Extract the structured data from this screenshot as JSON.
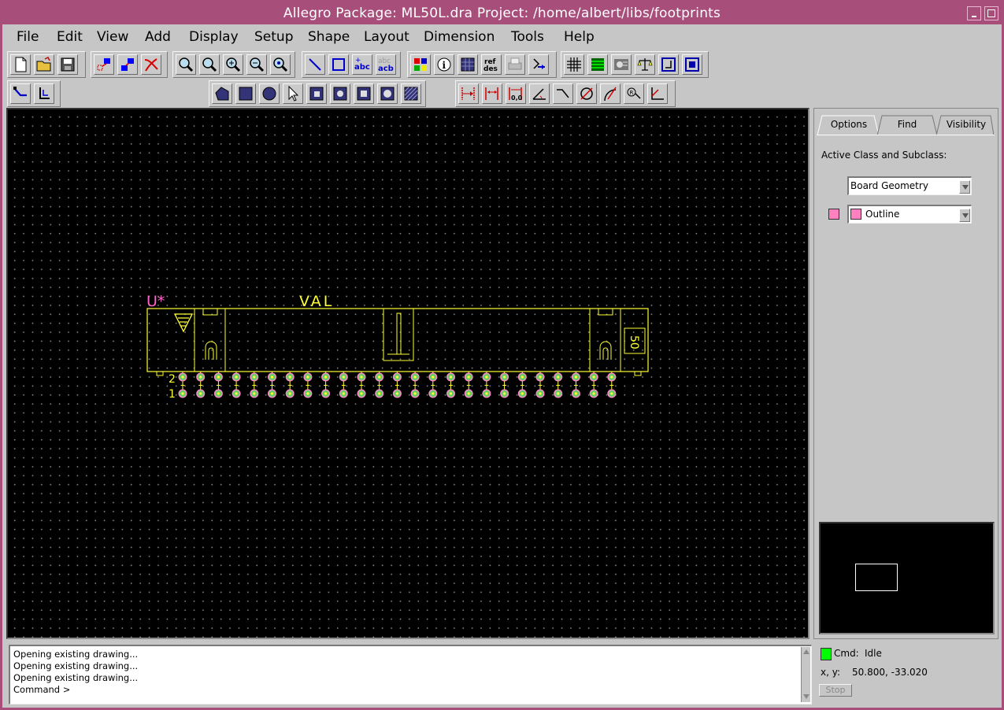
{
  "window": {
    "title": "Allegro Package: ML50L.dra  Project: /home/albert/libs/footprints"
  },
  "menu": [
    "File",
    "Edit",
    "View",
    "Add",
    "Display",
    "Setup",
    "Shape",
    "Layout",
    "Dimension",
    "Tools",
    "Help"
  ],
  "toolbar_icons": {
    "row1": [
      "new-file-icon",
      "open-file-icon",
      "save-icon",
      "move-icon",
      "copy-icon",
      "delete-icon",
      "zoom-points-icon",
      "zoom-fit-icon",
      "zoom-in-icon",
      "zoom-out-icon",
      "zoom-world-icon",
      "add-line-icon",
      "add-rect-icon",
      "add-text-icon",
      "edit-text-icon",
      "color-icon",
      "info-icon",
      "shade-icon",
      "refdes-icon",
      "print-icon",
      "pin-icon",
      "grid-icon",
      "layers-icon",
      "shapes-icon",
      "scale-icon",
      "snap-icon",
      "chip-icon"
    ],
    "row2": [
      "route-icon",
      "slide-icon",
      "shape-poly-icon",
      "shape-rect-icon",
      "shape-circle-icon",
      "select-icon",
      "shape-void-icon",
      "shape-merge-icon",
      "shape-edit-icon",
      "shape-fill-icon",
      "shape-hatch-icon",
      "dim-linear-icon",
      "dim-datum-icon",
      "dim-zero-icon",
      "dim-angle-icon",
      "dim-leader-icon",
      "dim-diameter-icon",
      "dim-radius-icon",
      "dim-balloon-icon",
      "dim-chamfer-icon"
    ]
  },
  "canvas": {
    "refdes_label": "U*",
    "value_label": "VAL",
    "pin_label_top": "2",
    "pin_label_bottom": "1",
    "pin_count_label": "50"
  },
  "panel": {
    "tabs": [
      "Options",
      "Find",
      "Visibility"
    ],
    "active_tab": "Options",
    "active_class_label": "Active Class and Subclass:",
    "class_value": "Board Geometry",
    "subclass_value": "Outline",
    "subclass_color": "#ff80c0"
  },
  "console": {
    "lines": [
      "Opening existing drawing...",
      "Opening existing drawing...",
      "Opening existing drawing...",
      "Command >"
    ]
  },
  "status": {
    "cmd_label": "Cmd:",
    "cmd_value": "Idle",
    "xy_label": "x, y:",
    "xy_value": "50.800, -33.020",
    "stop_label": "Stop",
    "led_color": "#00ff00"
  },
  "colors": {
    "title_bar": "#a84e7b",
    "part_outline": "#ffff33",
    "refdes": "#ff66cc",
    "pad_fill": "#66cc66",
    "pad_ring": "#ff88cc"
  }
}
